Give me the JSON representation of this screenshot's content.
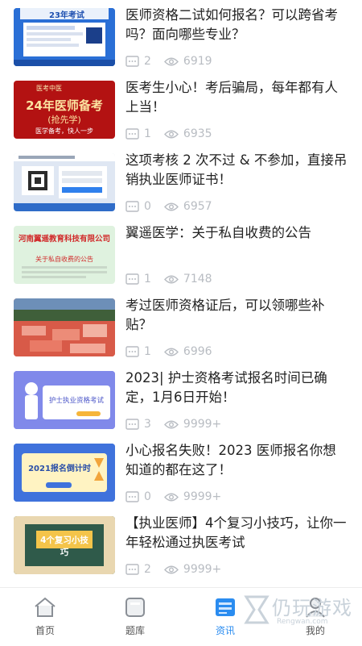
{
  "articles": [
    {
      "title": "医师资格二试如何报名？可以跨省考吗？面向哪些专业？",
      "comments": "2",
      "views": "6919",
      "thumb_caption": "23年考试"
    },
    {
      "title": "医考生小心！考后骗局，每年都有人上当！",
      "comments": "1",
      "views": "6935",
      "thumb_caption": "24年医师备考",
      "thumb_sub": "(抢先学)",
      "thumb_tag": "医学备考，快人一步",
      "thumb_brand": "医考中医"
    },
    {
      "title": "这项考核 2 次不过 & 不参加，直接吊销执业医师证书！",
      "comments": "0",
      "views": "6957"
    },
    {
      "title": "翼遥医学：关于私自收费的公告",
      "comments": "1",
      "views": "7148",
      "thumb_caption": "河南翼遥教育科技有限公司",
      "thumb_sub": "关于私自收费的公告"
    },
    {
      "title": "考过医师资格证后，可以领哪些补贴？",
      "comments": "1",
      "views": "6996"
    },
    {
      "title": "2023| 护士资格考试报名时间已确定，1月6日开始！",
      "comments": "3",
      "views": "9999+",
      "thumb_caption": "护士执业资格考试"
    },
    {
      "title": "小心报名失败！2023 医师报名你想知道的都在这了！",
      "comments": "0",
      "views": "9999+",
      "thumb_caption": "2021报名倒计时"
    },
    {
      "title": "【执业医师】4个复习小技巧，让你一年轻松通过执医考试",
      "comments": "2",
      "views": "9999+",
      "thumb_caption": "4个复习小技巧"
    }
  ],
  "tabbar": {
    "home": "首页",
    "questions": "题库",
    "news": "资讯",
    "mine": "我的"
  },
  "watermark": {
    "name": "仍玩游戏",
    "sub": "Rengwan.com"
  },
  "colors": {
    "accent": "#2a8cf0",
    "meta": "#b8bcc2"
  }
}
